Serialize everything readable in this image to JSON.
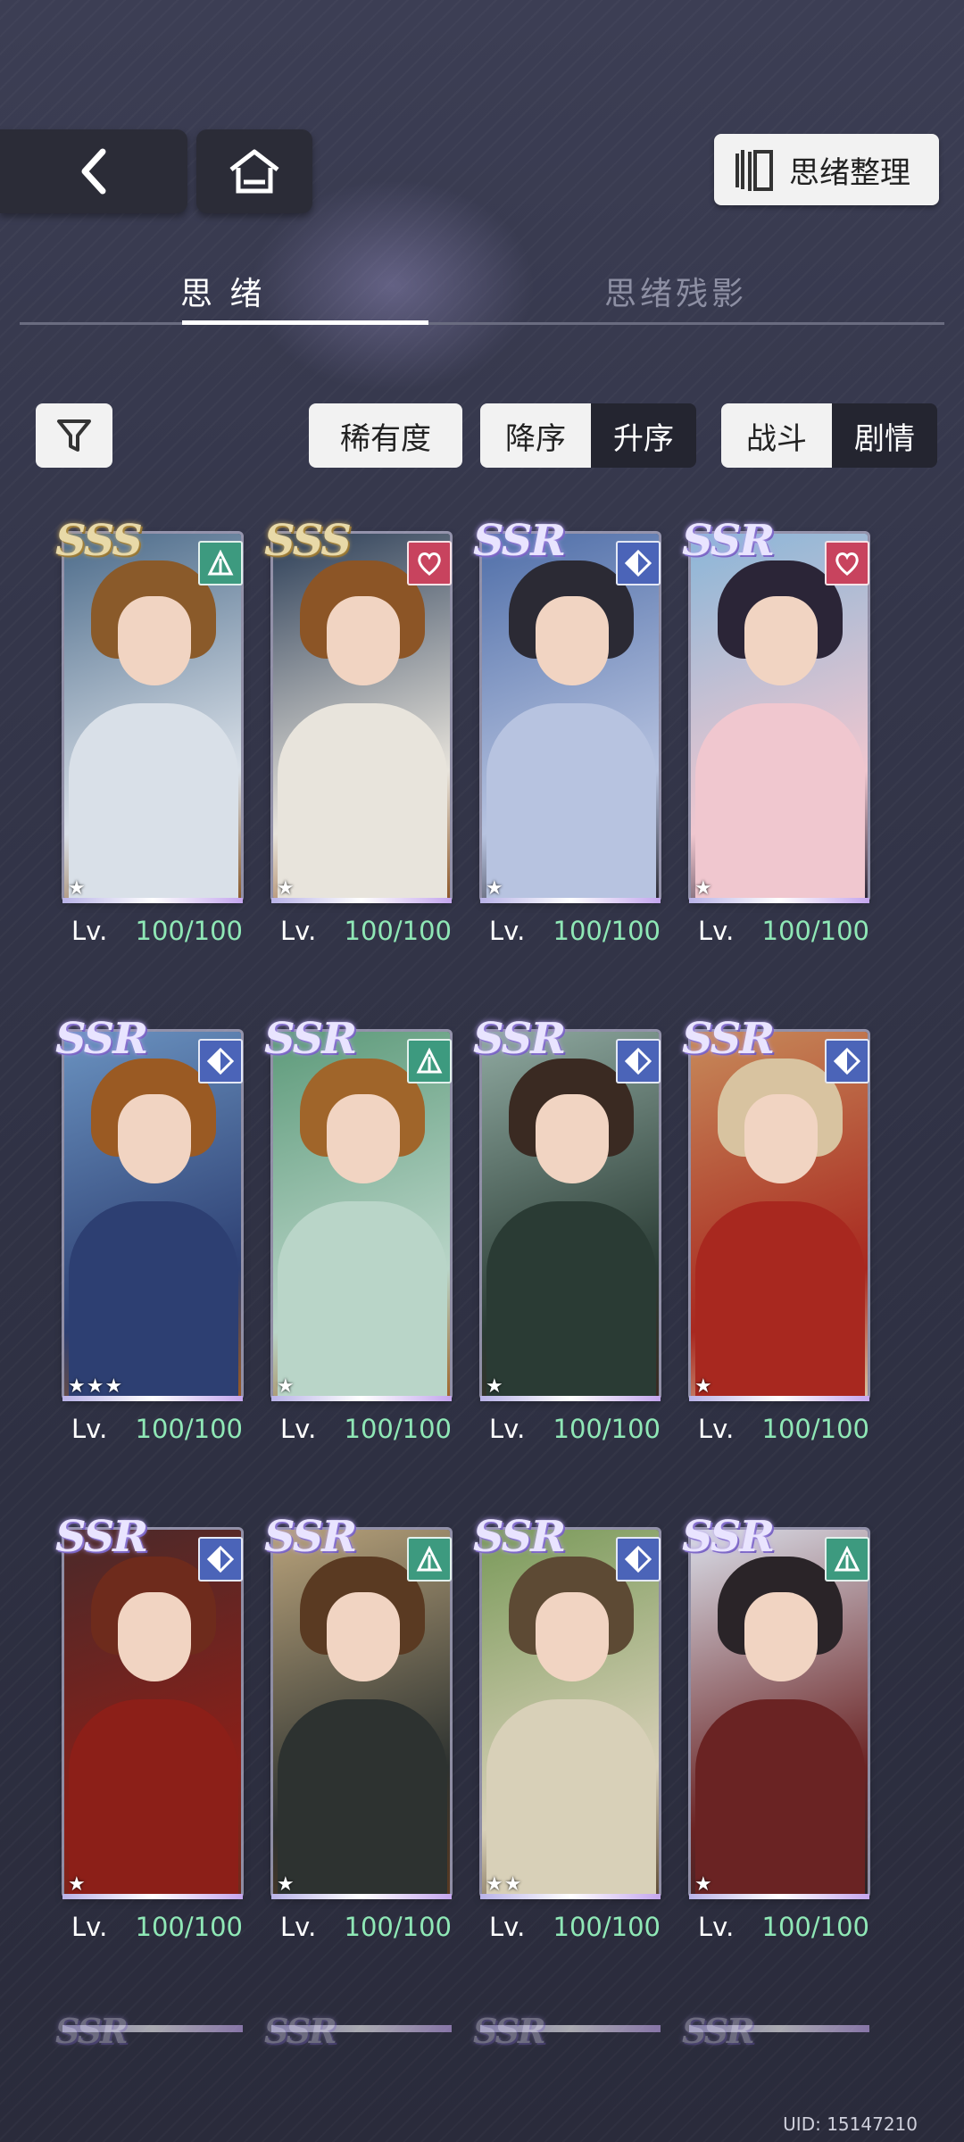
{
  "nav": {
    "back_icon": "chevron-left-icon",
    "home_icon": "home-icon",
    "organize_label": "思绪整理",
    "organize_icon": "cards-stack-icon"
  },
  "tabs": [
    {
      "label": "思 绪",
      "active": true
    },
    {
      "label": "思绪残影",
      "active": false
    }
  ],
  "filters": {
    "filter_icon": "filter-icon",
    "rarity_label": "稀有度",
    "desc_label": "降序",
    "asc_label": "升序",
    "battle_label": "战斗",
    "story_label": "剧情",
    "selected_order": "降序",
    "selected_category": "战斗"
  },
  "cards": [
    {
      "rarity": "SSS",
      "type": "green",
      "stars": "★",
      "level_label": "Lv.",
      "level": "100/100"
    },
    {
      "rarity": "SSS",
      "type": "red",
      "stars": "★",
      "level_label": "Lv.",
      "level": "100/100"
    },
    {
      "rarity": "SSR",
      "type": "blue",
      "stars": "★",
      "level_label": "Lv.",
      "level": "100/100"
    },
    {
      "rarity": "SSR",
      "type": "red",
      "stars": "★",
      "level_label": "Lv.",
      "level": "100/100"
    },
    {
      "rarity": "SSR",
      "type": "blue",
      "stars": "★★★",
      "level_label": "Lv.",
      "level": "100/100"
    },
    {
      "rarity": "SSR",
      "type": "green",
      "stars": "★",
      "level_label": "Lv.",
      "level": "100/100"
    },
    {
      "rarity": "SSR",
      "type": "blue",
      "stars": "★",
      "level_label": "Lv.",
      "level": "100/100"
    },
    {
      "rarity": "SSR",
      "type": "blue",
      "stars": "★",
      "level_label": "Lv.",
      "level": "100/100"
    },
    {
      "rarity": "SSR",
      "type": "blue",
      "stars": "★",
      "level_label": "Lv.",
      "level": "100/100"
    },
    {
      "rarity": "SSR",
      "type": "green",
      "stars": "★",
      "level_label": "Lv.",
      "level": "100/100"
    },
    {
      "rarity": "SSR",
      "type": "blue",
      "stars": "★★",
      "level_label": "Lv.",
      "level": "100/100"
    },
    {
      "rarity": "SSR",
      "type": "green",
      "stars": "★",
      "level_label": "Lv.",
      "level": "100/100"
    }
  ],
  "partial_row": [
    "SSR",
    "SSR",
    "SSR",
    "SSR"
  ],
  "uid": "UID: 15147210",
  "colors": {
    "level_value": "#8fe8b6",
    "type_blue": "#4b64b8",
    "type_green": "#3d9a7f",
    "type_red": "#c8435e"
  }
}
